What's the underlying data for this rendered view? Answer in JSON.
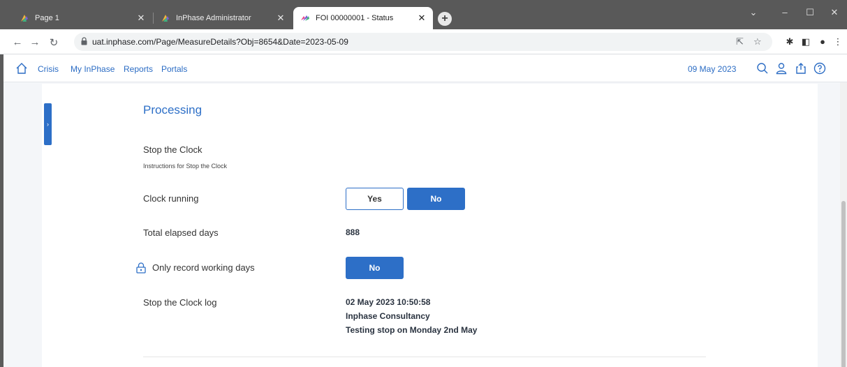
{
  "browser": {
    "tabs": [
      {
        "title": "Page 1",
        "active": false
      },
      {
        "title": "InPhase Administrator",
        "active": false
      },
      {
        "title": "FOI 00000001 - Status",
        "active": true
      }
    ],
    "url": "uat.inphase.com/Page/MeasureDetails?Obj=8654&Date=2023-05-09"
  },
  "nav": {
    "links": [
      "Crisis",
      "My InPhase",
      "Reports",
      "Portals"
    ],
    "date": "09 May 2023"
  },
  "main": {
    "section_title": "Processing",
    "stop_clock": {
      "title": "Stop the Clock",
      "instructions": "Instructions for Stop the Clock"
    },
    "clock_running": {
      "label": "Clock running",
      "yes_label": "Yes",
      "no_label": "No",
      "selected": "No"
    },
    "elapsed": {
      "label": "Total elapsed days",
      "value": "888"
    },
    "working_days": {
      "label": "Only record working days",
      "value_label": "No"
    },
    "log": {
      "label": "Stop the Clock log",
      "lines": [
        "02 May 2023 10:50:58",
        "Inphase Consultancy",
        "Testing stop on Monday 2nd May"
      ]
    }
  },
  "colors": {
    "accent": "#2d6fc7",
    "chrome_dark": "#595959"
  }
}
